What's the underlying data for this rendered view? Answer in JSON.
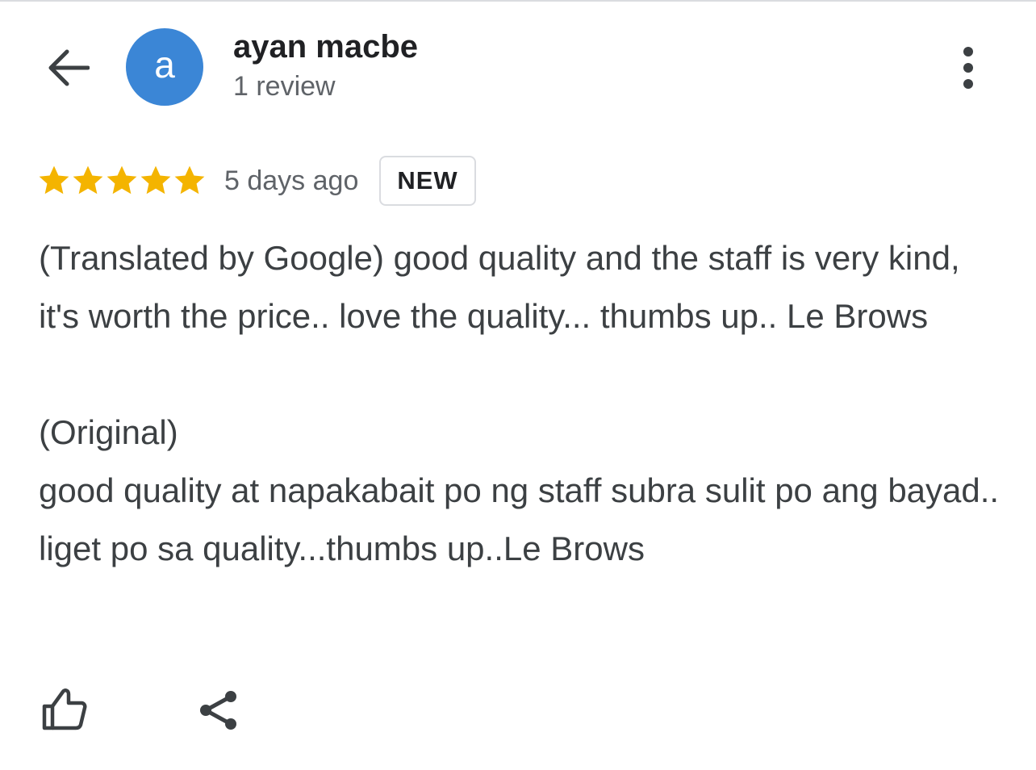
{
  "header": {
    "back_icon": "arrow-back-icon",
    "avatar_letter": "a",
    "avatar_color": "#3b86d6",
    "user_name": "ayan macbe",
    "review_count": "1 review",
    "more_icon": "more-vert-icon"
  },
  "review": {
    "rating": 5,
    "rating_max": 5,
    "star_color": "#f4b400",
    "time": "5 days ago",
    "badge": "NEW",
    "translated_text": "(Translated by Google) good quality and the staff is very kind, it's worth the price.. love the quality... thumbs up.. Le Brows",
    "original_label": "(Original)",
    "original_text": "good quality at napakabait po ng staff subra sulit po ang bayad.. liget po sa quality...thumbs up..Le Brows"
  },
  "actions": {
    "like_icon": "thumb-up-icon",
    "share_icon": "share-icon"
  }
}
